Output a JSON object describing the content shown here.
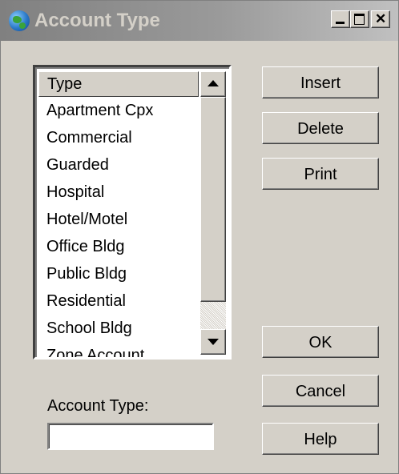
{
  "window": {
    "title": "Account Type",
    "icon": "globe-icon"
  },
  "title_buttons": {
    "minimize": "minimize-icon",
    "maximize": "maximize-icon",
    "close": "close-icon"
  },
  "listbox": {
    "column_header": "Type",
    "items": [
      "Apartment Cpx",
      "Commercial",
      "Guarded",
      "Hospital",
      "Hotel/Motel",
      "Office Bldg",
      "Public Bldg",
      "Residential",
      "School Bldg",
      "Zone Account"
    ]
  },
  "buttons": {
    "insert": "Insert",
    "delete": "Delete",
    "print": "Print",
    "ok": "OK",
    "cancel": "Cancel",
    "help": "Help"
  },
  "form": {
    "account_type_label": "Account Type:",
    "account_type_value": ""
  },
  "colors": {
    "dialog_bg": "#d4d0c8",
    "titlebar_inactive": "#808080",
    "title_text": "#d4d0c8"
  }
}
